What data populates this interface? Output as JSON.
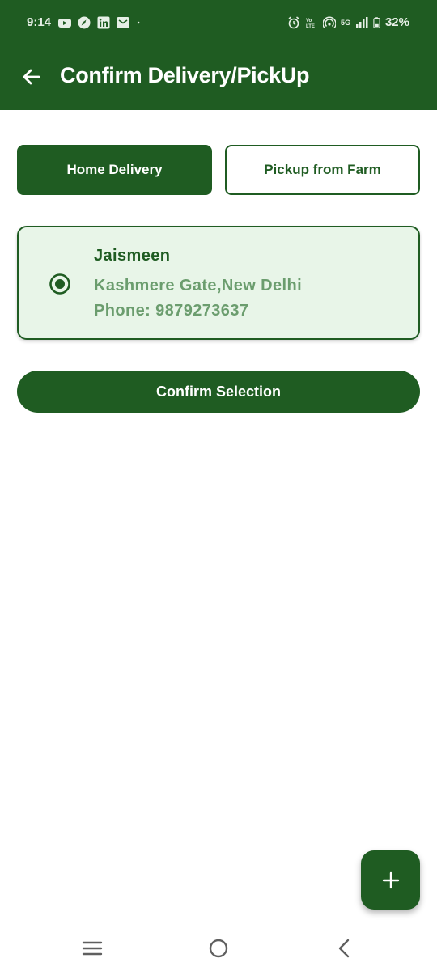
{
  "status_bar": {
    "time": "9:14",
    "battery": "32%",
    "network": "5G",
    "left_icons": [
      "youtube-icon",
      "compass-icon",
      "linkedin-icon",
      "mail-icon",
      "dot-icon"
    ],
    "right_icons": [
      "alarm-icon",
      "volte-icon",
      "hotspot-icon",
      "signal-icon",
      "battery-icon"
    ]
  },
  "app_bar": {
    "title": "Confirm Delivery/PickUp",
    "back_icon": "arrow-left-icon"
  },
  "delivery_options": {
    "home_label": "Home Delivery",
    "pickup_label": "Pickup from Farm",
    "selected": "Home Delivery"
  },
  "address": {
    "name": "Jaismeen",
    "line": "Kashmere Gate,New Delhi",
    "phone": "Phone: 9879273637",
    "selected": true
  },
  "confirm_button": {
    "label": "Confirm Selection"
  },
  "fab": {
    "icon": "plus-icon"
  },
  "nav_bar": {
    "icons": [
      "menu-icon",
      "home-circle-icon",
      "back-chevron-icon"
    ]
  },
  "colors": {
    "primary": "#1f5c22",
    "card_bg": "#e8f5e8",
    "muted_green": "#6b9d6e"
  }
}
